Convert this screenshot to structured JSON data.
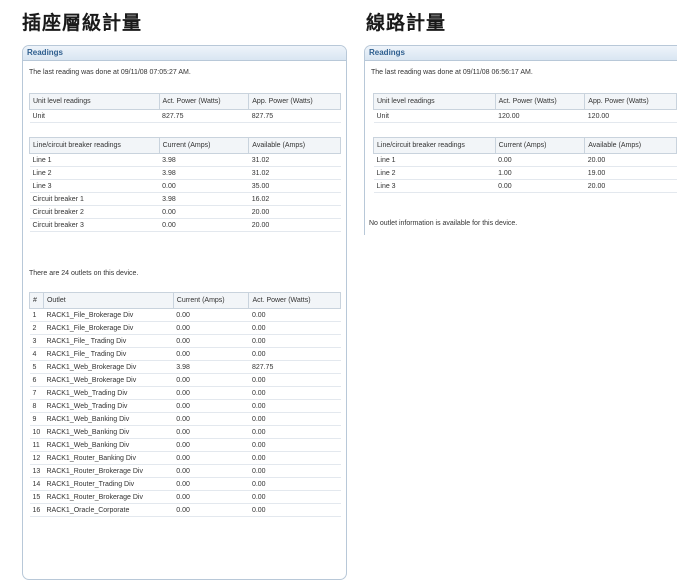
{
  "headings": {
    "left": "插座層級計量",
    "right": "線路計量"
  },
  "left_panel": {
    "title": "Readings",
    "last_reading": "The last reading was done at 09/11/08 07:05:27 AM.",
    "unit_table": {
      "headers": [
        "Unit level readings",
        "Act. Power (Watts)",
        "App. Power (Watts)"
      ],
      "rows": [
        [
          "Unit",
          "827.75",
          "827.75"
        ]
      ]
    },
    "line_table": {
      "headers": [
        "Line/circuit breaker readings",
        "Current (Amps)",
        "Available (Amps)"
      ],
      "rows": [
        [
          "Line 1",
          "3.98",
          "31.02"
        ],
        [
          "Line 2",
          "3.98",
          "31.02"
        ],
        [
          "Line 3",
          "0.00",
          "35.00"
        ],
        [
          "Circuit breaker 1",
          "3.98",
          "16.02"
        ],
        [
          "Circuit breaker 2",
          "0.00",
          "20.00"
        ],
        [
          "Circuit breaker 3",
          "0.00",
          "20.00"
        ]
      ]
    },
    "outlet_count_text": "There are 24 outlets on this device.",
    "outlet_table": {
      "headers": [
        "#",
        "Outlet",
        "Current (Amps)",
        "Act. Power (Watts)"
      ],
      "rows": [
        [
          "1",
          "RACK1_File_Brokerage Div",
          "0.00",
          "0.00"
        ],
        [
          "2",
          "RACK1_File_Brokerage Div",
          "0.00",
          "0.00"
        ],
        [
          "3",
          "RACK1_File_ Trading Div",
          "0.00",
          "0.00"
        ],
        [
          "4",
          "RACK1_File_ Trading Div",
          "0.00",
          "0.00"
        ],
        [
          "5",
          "RACK1_Web_Brokerage Div",
          "3.98",
          "827.75"
        ],
        [
          "6",
          "RACK1_Web_Brokerage Div",
          "0.00",
          "0.00"
        ],
        [
          "7",
          "RACK1_Web_Trading Div",
          "0.00",
          "0.00"
        ],
        [
          "8",
          "RACK1_Web_Trading Div",
          "0.00",
          "0.00"
        ],
        [
          "9",
          "RACK1_Web_Banking Div",
          "0.00",
          "0.00"
        ],
        [
          "10",
          "RACK1_Web_Banking Div",
          "0.00",
          "0.00"
        ],
        [
          "11",
          "RACK1_Web_Banking Div",
          "0.00",
          "0.00"
        ],
        [
          "12",
          "RACK1_Router_Banking Div",
          "0.00",
          "0.00"
        ],
        [
          "13",
          "RACK1_Router_Brokerage Div",
          "0.00",
          "0.00"
        ],
        [
          "14",
          "RACK1_Router_Trading Div",
          "0.00",
          "0.00"
        ],
        [
          "15",
          "RACK1_Router_Brokerage Div",
          "0.00",
          "0.00"
        ],
        [
          "16",
          "RACK1_Oracle_Corporate",
          "0.00",
          "0.00"
        ]
      ]
    }
  },
  "right_panel": {
    "title": "Readings",
    "last_reading": "The last reading was done at 09/11/08 06:56:17 AM.",
    "unit_table": {
      "headers": [
        "Unit level readings",
        "Act. Power (Watts)",
        "App. Power (Watts)"
      ],
      "rows": [
        [
          "Unit",
          "120.00",
          "120.00"
        ]
      ]
    },
    "line_table": {
      "headers": [
        "Line/circuit breaker readings",
        "Current (Amps)",
        "Available (Amps)"
      ],
      "rows": [
        [
          "Line 1",
          "0.00",
          "20.00"
        ],
        [
          "Line 2",
          "1.00",
          "19.00"
        ],
        [
          "Line 3",
          "0.00",
          "20.00"
        ]
      ]
    },
    "no_outlet_text": "No outlet information is available for this device."
  }
}
